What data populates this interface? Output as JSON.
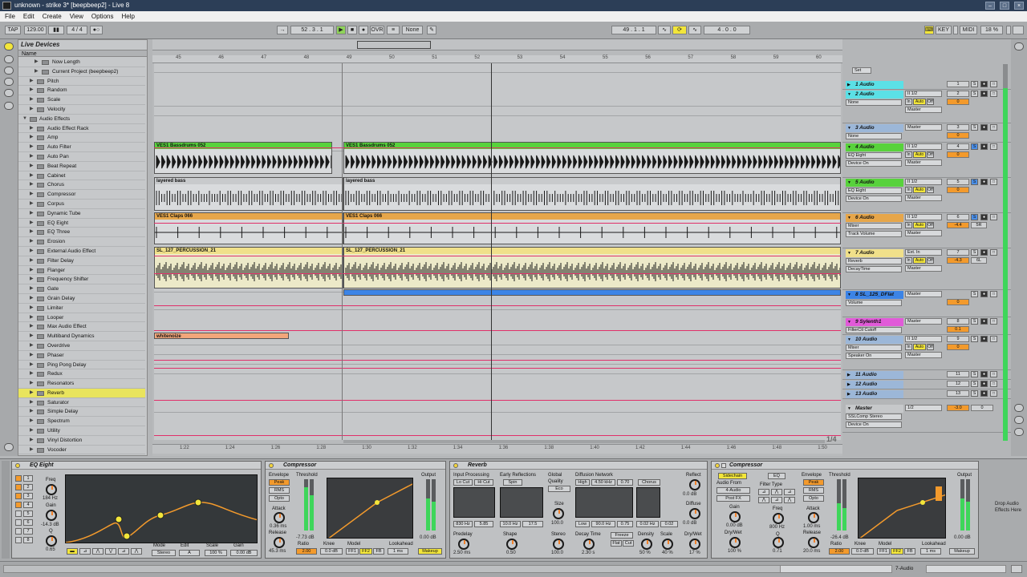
{
  "window": {
    "title": "unknown - strike 3* [beepbeep2] - Live 8"
  },
  "menu": [
    "File",
    "Edit",
    "Create",
    "View",
    "Options",
    "Help"
  ],
  "transport": {
    "tap": "TAP",
    "tempo": "129.00",
    "sig": "4 / 4",
    "position": "52 . 3 . 1",
    "ovr": "OVR",
    "quant": "None",
    "loop_start": "49 . 1 . 1",
    "loop_len": "4 . 0 . 0",
    "key": "KEY",
    "midi": "MIDI",
    "cpu": "18 %"
  },
  "browser": {
    "title": "Live Devices",
    "column": "Name",
    "items": [
      {
        "label": "Now Length",
        "level": 2
      },
      {
        "label": "Current Project (beepbeep2)",
        "level": 2
      },
      {
        "label": "Pitch",
        "level": 1
      },
      {
        "label": "Random",
        "level": 1
      },
      {
        "label": "Scale",
        "level": 1
      },
      {
        "label": "Velocity",
        "level": 1
      },
      {
        "label": "Audio Effects",
        "level": 0
      },
      {
        "label": "Audio Effect Rack",
        "level": 1
      },
      {
        "label": "Amp",
        "level": 1
      },
      {
        "label": "Auto Filter",
        "level": 1
      },
      {
        "label": "Auto Pan",
        "level": 1
      },
      {
        "label": "Beat Repeat",
        "level": 1
      },
      {
        "label": "Cabinet",
        "level": 1
      },
      {
        "label": "Chorus",
        "level": 1
      },
      {
        "label": "Compressor",
        "level": 1
      },
      {
        "label": "Corpus",
        "level": 1
      },
      {
        "label": "Dynamic Tube",
        "level": 1
      },
      {
        "label": "EQ Eight",
        "level": 1
      },
      {
        "label": "EQ Three",
        "level": 1
      },
      {
        "label": "Erosion",
        "level": 1
      },
      {
        "label": "External Audio Effect",
        "level": 1
      },
      {
        "label": "Filter Delay",
        "level": 1
      },
      {
        "label": "Flanger",
        "level": 1
      },
      {
        "label": "Frequency Shifter",
        "level": 1
      },
      {
        "label": "Gate",
        "level": 1
      },
      {
        "label": "Grain Delay",
        "level": 1
      },
      {
        "label": "Limiter",
        "level": 1
      },
      {
        "label": "Looper",
        "level": 1
      },
      {
        "label": "Max Audio Effect",
        "level": 1
      },
      {
        "label": "Multiband Dynamics",
        "level": 1
      },
      {
        "label": "Overdrive",
        "level": 1
      },
      {
        "label": "Phaser",
        "level": 1
      },
      {
        "label": "Ping Pong Delay",
        "level": 1
      },
      {
        "label": "Redux",
        "level": 1
      },
      {
        "label": "Resonators",
        "level": 1
      },
      {
        "label": "Reverb",
        "level": 1,
        "selected": true
      },
      {
        "label": "Saturator",
        "level": 1
      },
      {
        "label": "Simple Delay",
        "level": 1
      },
      {
        "label": "Spectrum",
        "level": 1
      },
      {
        "label": "Utility",
        "level": 1
      },
      {
        "label": "Vinyl Distortion",
        "level": 1
      },
      {
        "label": "Vocoder",
        "level": 1
      }
    ]
  },
  "ruler": {
    "bars": [
      "45",
      "46",
      "47",
      "48",
      "49",
      "50",
      "51",
      "52",
      "53",
      "54",
      "55",
      "56",
      "57",
      "58",
      "59",
      "60"
    ],
    "times": [
      "1:22",
      "1:24",
      "1:26",
      "1:28",
      "1:30",
      "1:32",
      "1:34",
      "1:36",
      "1:38",
      "1:40",
      "1:42",
      "1:44",
      "1:46",
      "1:48",
      "1:50"
    ],
    "page": "1/4"
  },
  "clips": {
    "bassdrum_a": "VES1 Bassdrums 052",
    "bassdrum_b": "VES1 Bassdrums 052",
    "bass_a": "layered bass",
    "bass_b": "layered bass",
    "claps_a": "VES1 Claps 066",
    "claps_b": "VES1 Claps 066",
    "perc_a": "SL_127_PERCUSSION_21",
    "perc_b": "SL_127_PERCUSSION_21",
    "whitenoise": "whitenoize"
  },
  "mixer": {
    "set_label": "Set",
    "tracks": [
      {
        "name": "1 Audio",
        "color": "#5be0e6",
        "num": "1",
        "io": "",
        "vol": "",
        "closed": true
      },
      {
        "name": "2 Audio",
        "color": "#5be0e6",
        "num": "2",
        "io": "II 1/2",
        "dev": "None",
        "out": "Master",
        "vol": "0"
      },
      {
        "name": "3 Audio",
        "color": "#9cb7d8",
        "num": "3",
        "io": "Master",
        "dev": "None",
        "vol": "0"
      },
      {
        "name": "4 Audio",
        "color": "#58d23c",
        "num": "4",
        "io": "II 1/2",
        "dev": "EQ Eight",
        "dev2": "Device On",
        "out": "Master",
        "vol": "0"
      },
      {
        "name": "5 Audio",
        "color": "#58d23c",
        "num": "5",
        "io": "II 1/2",
        "dev": "EQ Eight",
        "dev2": "Device On",
        "out": "Master",
        "vol": "0"
      },
      {
        "name": "6 Audio",
        "color": "#e6a64a",
        "num": "6",
        "io": "II 1/2",
        "dev": "Mixer",
        "dev2": "Track Volume",
        "out": "Master",
        "vol": "-4.4",
        "pan": "5R"
      },
      {
        "name": "7 Audio",
        "color": "#f0e08a",
        "num": "7",
        "io": "Ext. In",
        "dev": "Reverb",
        "dev2": "DecayTime",
        "out": "Master",
        "vol": "-4.3",
        "pan": "6L"
      },
      {
        "name": "8 SL_125_DFlat",
        "color": "#3c84e6",
        "num": "",
        "io": "Master",
        "dev": "Volume",
        "vol": "0"
      },
      {
        "name": "9 Sylenth1",
        "color": "#e15ad8",
        "num": "8",
        "io": "Master",
        "dev": "FilterCtl Cutoff",
        "vol": "0.1"
      },
      {
        "name": "10 Audio",
        "color": "#9cb7d8",
        "num": "9",
        "io": "II 1/2",
        "dev": "Mixer",
        "dev2": "Speaker On",
        "out": "Master",
        "vol": "0"
      },
      {
        "name": "11 Audio",
        "color": "#9cb7d8",
        "num": "11",
        "closed": true
      },
      {
        "name": "12 Audio",
        "color": "#9cb7d8",
        "num": "12",
        "closed": true
      },
      {
        "name": "13 Audio",
        "color": "#9cb7d8",
        "num": "13",
        "closed": true
      }
    ],
    "master": {
      "name": "Master",
      "dev": "SSLComp Stereo",
      "dev2": "Device On",
      "io": "1/2",
      "vol": "-3.0",
      "pan": "0"
    }
  },
  "devices": {
    "eq": {
      "title": "EQ Eight",
      "freq_label": "Freq",
      "freq": "184 Hz",
      "gain_label": "Gain",
      "gain": "-14.3 dB",
      "q_label": "Q",
      "q": "0.65",
      "mode_label": "Mode",
      "mode": "Stereo",
      "edit_label": "Edit",
      "scale_label": "Scale",
      "scale": "100 %",
      "out_gain_label": "Gain",
      "out_gain": "0.00 dB",
      "bands": [
        "1",
        "2",
        "3",
        "4",
        "5",
        "6",
        "7",
        "8"
      ]
    },
    "comp1": {
      "title": "Compressor",
      "envelope": "Envelope",
      "peak": "Peak",
      "rms": "RMS",
      "opto": "Opto",
      "threshold_label": "Threshold",
      "threshold": "-7.73 dB",
      "attack_label": "Attack",
      "attack": "0.36 ms",
      "release_label": "Release",
      "release": "45.3 ms",
      "ratio_label": "Ratio",
      "ratio": "2.00",
      "knee_label": "Knee",
      "knee": "0.0 dB",
      "model_label": "Model",
      "model": "FF1",
      "model2": "FF2",
      "model3": "FB",
      "lookahead_label": "Lookahead",
      "lookahead": "1 ms",
      "output_label": "Output",
      "output": "0.00 dB",
      "makeup": "Makeup"
    },
    "reverb": {
      "title": "Reverb",
      "input": "Input Processing",
      "locut": "Lo Cut",
      "hicut": "Hi Cut",
      "early": "Early Reflections",
      "spin": "Spin",
      "global": "Global",
      "quality_label": "Quality",
      "quality": "Eco",
      "diffusion": "Diffusion Network",
      "high": "High",
      "high_val": "4.50 kHz",
      "high_q": "0.70",
      "chorus": "Chorus",
      "low": "Low",
      "low_val": "90.0 Hz",
      "low_q": "0.75",
      "dn_val": "0.02 Hz",
      "dn_val2": "0.02",
      "in_freq": "830 Hz",
      "in_q": "5.85",
      "er_val": "10.0 Hz",
      "er_val2": "17.5",
      "size_label": "Size",
      "size": "100.0",
      "predelay_label": "Predelay",
      "predelay": "2.50 ms",
      "shape_label": "Shape",
      "shape": "0.50",
      "stereo_label": "Stereo",
      "stereo": "100.0",
      "decay_label": "Decay Time",
      "decay": "2.30 s",
      "freeze": "Freeze",
      "flat": "Flat",
      "cut": "Cut",
      "density_label": "Density",
      "density": "50 %",
      "scale_label": "Scale",
      "scale": "40 %",
      "reflect_label": "Reflect",
      "reflect": "0.0 dB",
      "diffuse_label": "Diffuse",
      "diffuse": "0.0 dB",
      "drywet_label": "Dry/Wet",
      "drywet": "17 %"
    },
    "comp2": {
      "title": "Compressor",
      "sidechain": "Sidechain",
      "eq": "EQ",
      "audio_from_label": "Audio From",
      "audio_from": "4-Audio",
      "post_fx": "Post FX",
      "gain_label": "Gain",
      "gain": "0.00 dB",
      "drywet_label": "Dry/Wet",
      "drywet": "100 %",
      "filter_label": "Filter Type",
      "freq_label": "Freq",
      "freq": "800 Hz",
      "q_label": "Q",
      "q": "0.71",
      "envelope": "Envelope",
      "peak": "Peak",
      "rms": "RMS",
      "opto": "Opto",
      "attack_label": "Attack",
      "attack": "1.00 ms",
      "release_label": "Release",
      "release": "20.0 ms",
      "threshold_label": "Threshold",
      "threshold": "-26.4 dB",
      "ratio_label": "Ratio",
      "ratio": "2.00",
      "knee_label": "Knee",
      "knee": "0.0 dB",
      "model_label": "Model",
      "model": "FF1",
      "model2": "FF2",
      "model3": "FB",
      "lookahead_label": "Lookahead",
      "lookahead": "1 ms",
      "output_label": "Output",
      "output": "0.00 dB",
      "makeup": "Makeup"
    },
    "drop_hint": "Drop Audio Effects Here"
  },
  "status": {
    "track": "7-Audio"
  },
  "colors": {
    "green": "#58d23c",
    "orange": "#e6a64a",
    "yellow": "#f0e08a",
    "blue": "#3c84e6",
    "pink": "#e0306a",
    "selection": "#e9e45d"
  }
}
